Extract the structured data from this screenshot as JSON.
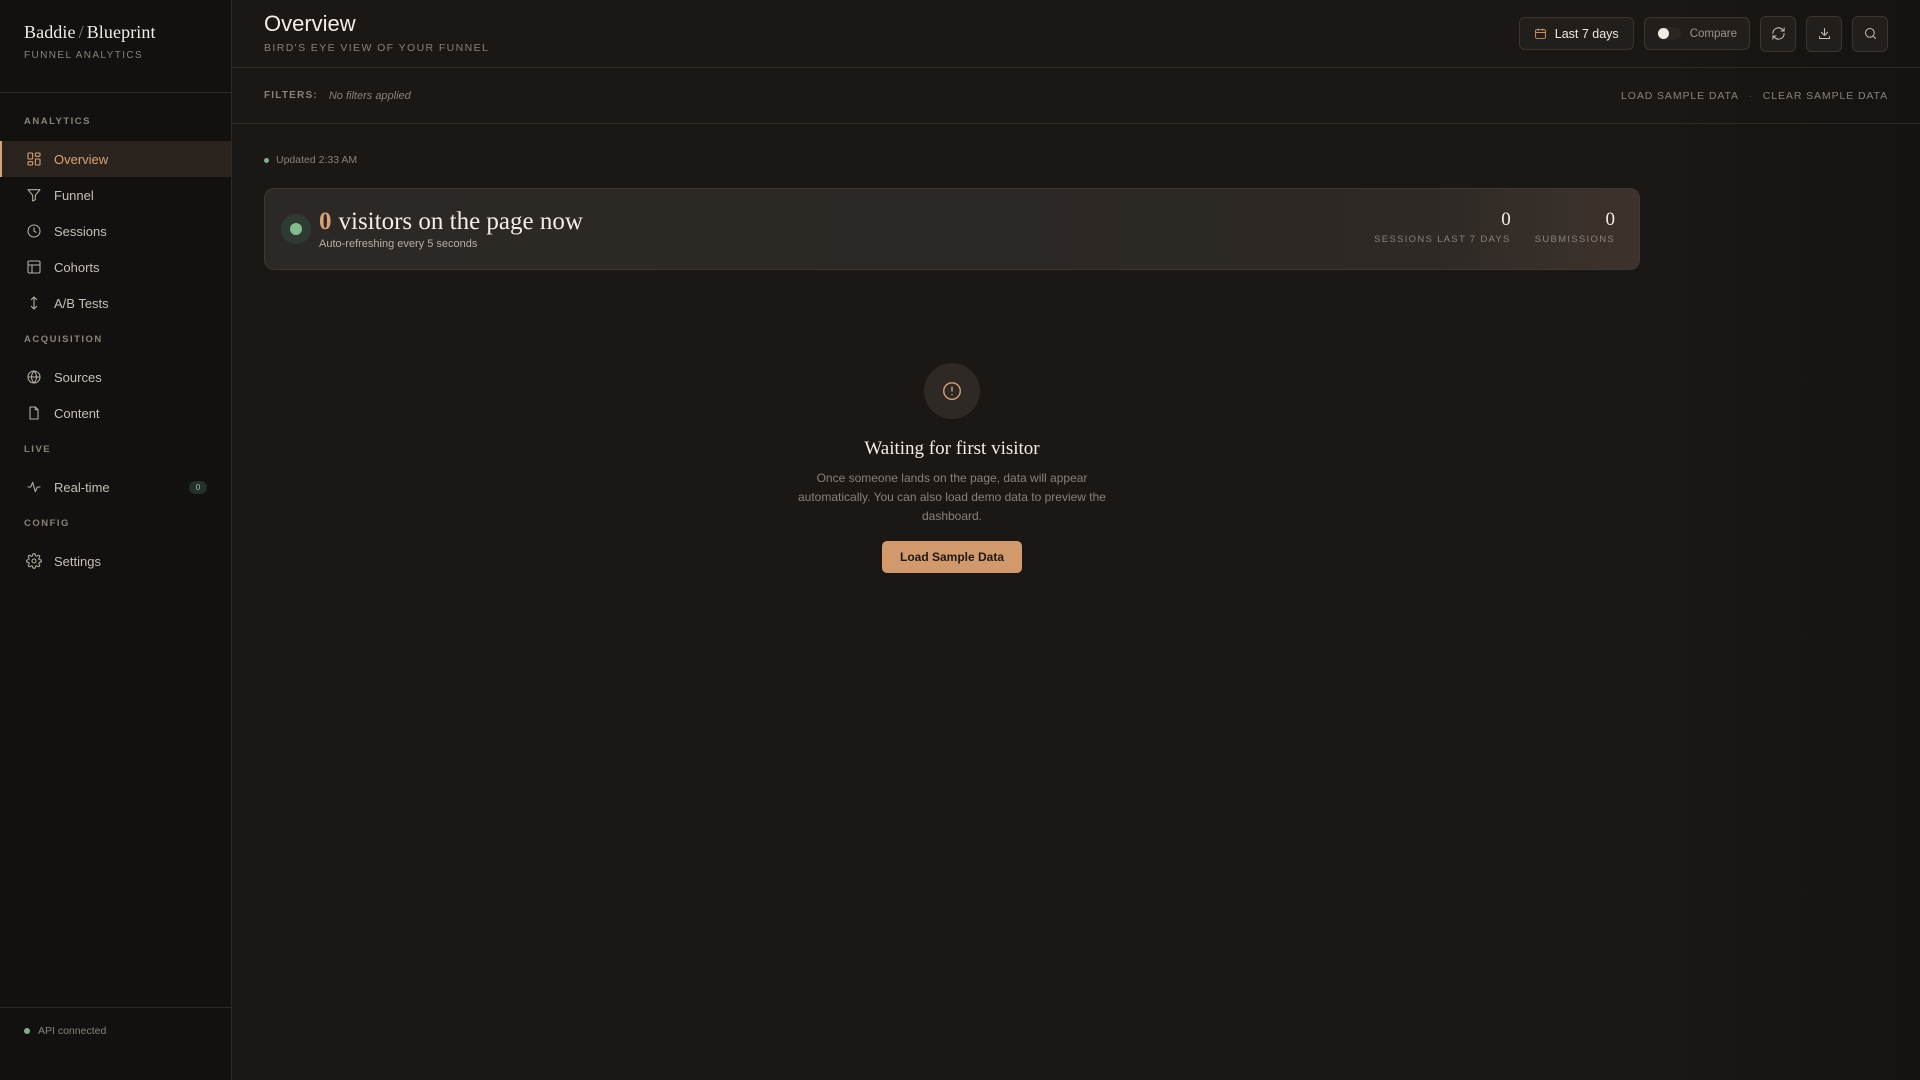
{
  "brand": {
    "name": "Baddie",
    "separator": "/",
    "product": "Blueprint",
    "subtitle": "FUNNEL ANALYTICS"
  },
  "sidebar": {
    "sections": [
      {
        "title": "ANALYTICS",
        "items": [
          {
            "label": "Overview",
            "icon": "dashboard-icon",
            "active": true
          },
          {
            "label": "Funnel",
            "icon": "funnel-icon"
          },
          {
            "label": "Sessions",
            "icon": "clock-icon"
          },
          {
            "label": "Cohorts",
            "icon": "table-icon"
          },
          {
            "label": "A/B Tests",
            "icon": "split-arrows-icon"
          }
        ]
      },
      {
        "title": "ACQUISITION",
        "items": [
          {
            "label": "Sources",
            "icon": "globe-icon"
          },
          {
            "label": "Content",
            "icon": "document-icon"
          }
        ]
      },
      {
        "title": "LIVE",
        "items": [
          {
            "label": "Real-time",
            "icon": "activity-icon",
            "badge": "0"
          }
        ]
      },
      {
        "title": "CONFIG",
        "items": [
          {
            "label": "Settings",
            "icon": "gear-icon"
          }
        ]
      }
    ],
    "footer": {
      "status": "API connected",
      "status_color": "#7fb08a"
    }
  },
  "header": {
    "title": "Overview",
    "subtitle": "BIRD'S EYE VIEW OF YOUR FUNNEL",
    "date_range": "Last 7 days",
    "compare_label": "Compare",
    "compare_enabled": false,
    "icons": [
      "calendar-icon",
      "refresh-icon",
      "download-icon",
      "search-icon"
    ]
  },
  "filters": {
    "label": "FILTERS:",
    "value": "No filters applied",
    "load_sample": "LOAD SAMPLE DATA",
    "separator": "·",
    "clear_sample": "CLEAR SAMPLE DATA"
  },
  "status": {
    "updated": "Updated 2:33 AM"
  },
  "live": {
    "count": "0",
    "headline": "visitors on the page now",
    "subtitle": "Auto-refreshing every 5 seconds",
    "stats": [
      {
        "value": "0",
        "label": "SESSIONS LAST 7 DAYS"
      },
      {
        "value": "0",
        "label": "SUBMISSIONS"
      }
    ]
  },
  "empty_state": {
    "icon": "info-icon",
    "title": "Waiting for first visitor",
    "description": "Once someone lands on the page, data will appear automatically. You can also load demo data to preview the dashboard.",
    "button": "Load Sample Data"
  },
  "colors": {
    "accent": "#d8a274",
    "live_green": "#84bb8e",
    "background": "#1a1714",
    "sidebar": "#13110f"
  }
}
